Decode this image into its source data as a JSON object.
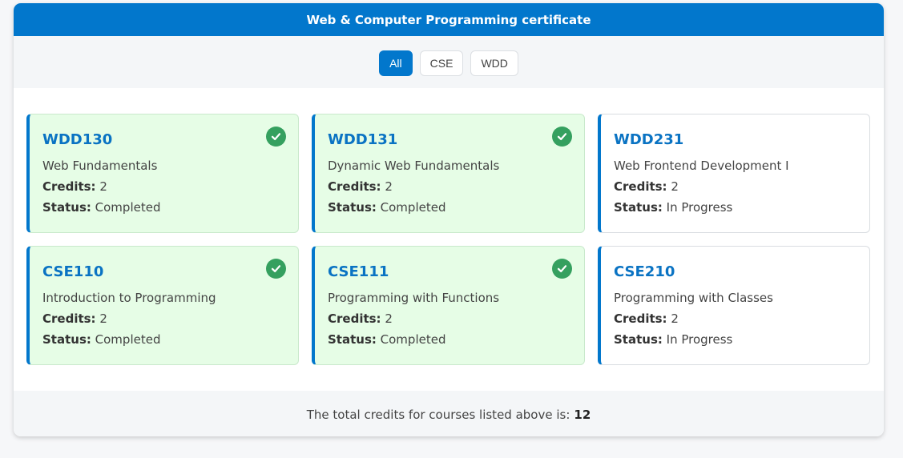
{
  "header": {
    "title": "Web & Computer Programming certificate"
  },
  "filters": [
    {
      "label": "All",
      "active": true
    },
    {
      "label": "CSE",
      "active": false
    },
    {
      "label": "WDD",
      "active": false
    }
  ],
  "labels": {
    "credits": "Credits:",
    "status": "Status:"
  },
  "courses": [
    {
      "code": "WDD130",
      "name": "Web Fundamentals",
      "credits": "2",
      "status": "Completed",
      "completed": true
    },
    {
      "code": "WDD131",
      "name": "Dynamic Web Fundamentals",
      "credits": "2",
      "status": "Completed",
      "completed": true
    },
    {
      "code": "WDD231",
      "name": "Web Frontend Development I",
      "credits": "2",
      "status": "In Progress",
      "completed": false
    },
    {
      "code": "CSE110",
      "name": "Introduction to Programming",
      "credits": "2",
      "status": "Completed",
      "completed": true
    },
    {
      "code": "CSE111",
      "name": "Programming with Functions",
      "credits": "2",
      "status": "Completed",
      "completed": true
    },
    {
      "code": "CSE210",
      "name": "Programming with Classes",
      "credits": "2",
      "status": "In Progress",
      "completed": false
    }
  ],
  "footer": {
    "text": "The total credits for courses listed above is:",
    "total": "12"
  },
  "colors": {
    "accent": "#0277cc",
    "completed_bg": "#e6fde6",
    "check": "#35a05f"
  },
  "icons": {
    "completed": "check-circle-icon"
  }
}
